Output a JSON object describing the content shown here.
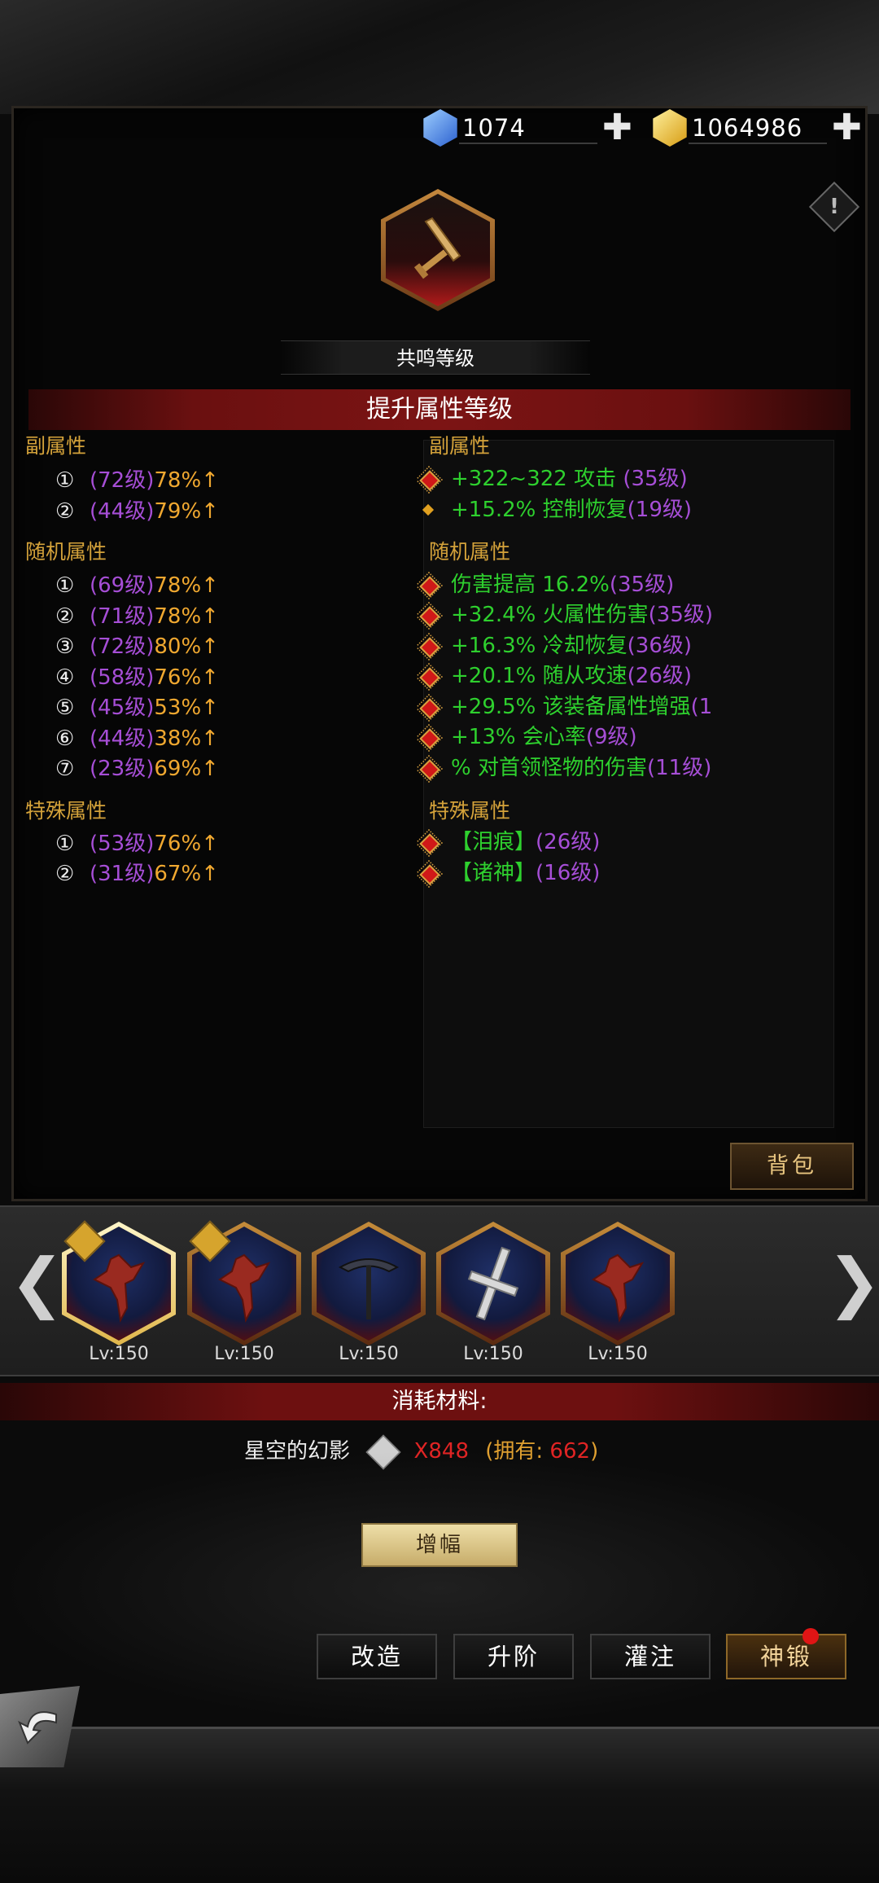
{
  "currency": {
    "gems": "1074",
    "gold": "1064986",
    "plus": "✚",
    "gem_color": "#3f7fe0",
    "gold_color": "#f0c030"
  },
  "info_icon": "!",
  "resonance_label": "共鸣等级",
  "title": "提升属性等级",
  "left": {
    "sub_header": "副属性",
    "sub": [
      {
        "num": "①",
        "lv": "(72级)",
        "pct": "78%↑"
      },
      {
        "num": "②",
        "lv": "(44级)",
        "pct": "79%↑"
      }
    ],
    "random_header": "随机属性",
    "random": [
      {
        "num": "①",
        "lv": "(69级)",
        "pct": "78%↑"
      },
      {
        "num": "②",
        "lv": "(71级)",
        "pct": "78%↑"
      },
      {
        "num": "③",
        "lv": "(72级)",
        "pct": "80%↑"
      },
      {
        "num": "④",
        "lv": "(58级)",
        "pct": "76%↑"
      },
      {
        "num": "⑤",
        "lv": "(45级)",
        "pct": "53%↑"
      },
      {
        "num": "⑥",
        "lv": "(44级)",
        "pct": "38%↑"
      },
      {
        "num": "⑦",
        "lv": "(23级)",
        "pct": "69%↑"
      }
    ],
    "special_header": "特殊属性",
    "special": [
      {
        "num": "①",
        "lv": "(53级)",
        "pct": "76%↑"
      },
      {
        "num": "②",
        "lv": "(31级)",
        "pct": "67%↑"
      }
    ]
  },
  "right": {
    "sub_header": "副属性",
    "sub": [
      {
        "text": "+322~322 攻击 ",
        "lv": "(35级)"
      },
      {
        "text": "+15.2% 控制恢复",
        "lv": "(19级)"
      }
    ],
    "random_header": "随机属性",
    "random": [
      {
        "text": "伤害提高 16.2%",
        "lv": "(35级)"
      },
      {
        "text": "+32.4% 火属性伤害",
        "lv": "(35级)"
      },
      {
        "text": "+16.3% 冷却恢复",
        "lv": "(36级)"
      },
      {
        "text": "+20.1% 随从攻速",
        "lv": "(26级)"
      },
      {
        "text": "+29.5% 该装备属性增强",
        "lv": "(1"
      },
      {
        "text": "+13% 会心率",
        "lv": "(9级)"
      },
      {
        "text": "% 对首领怪物的伤害",
        "lv": "(11级)"
      }
    ],
    "special_header": "特殊属性",
    "special": [
      {
        "text": "【泪痕】",
        "lv": "(26级)"
      },
      {
        "text": "【诸神】",
        "lv": "(16级)"
      }
    ]
  },
  "bag_label": "背包",
  "items": [
    {
      "level": "Lv:150",
      "icon": "dragon-icon"
    },
    {
      "level": "Lv:150",
      "icon": "dragon-icon"
    },
    {
      "level": "Lv:150",
      "icon": "scythe-icon"
    },
    {
      "level": "Lv:150",
      "icon": "cross-sword-icon"
    },
    {
      "level": "Lv:150",
      "icon": "dragon-icon"
    }
  ],
  "nav": {
    "prev": "❮",
    "next": "❯"
  },
  "materials": {
    "header": "消耗材料:",
    "name": "星空的幻影",
    "qty": "X848",
    "owned_prefix": "(拥有: ",
    "owned": "662",
    "owned_suffix": ")"
  },
  "amplify_label": "增幅",
  "tabs": [
    "改造",
    "升阶",
    "灌注",
    "神锻"
  ]
}
